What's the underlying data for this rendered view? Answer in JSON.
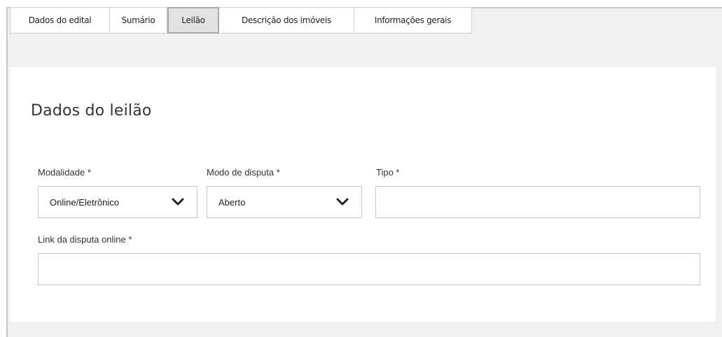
{
  "tabs": [
    {
      "label": "Dados do edital",
      "active": false
    },
    {
      "label": "Sumário",
      "active": false
    },
    {
      "label": "Leilão",
      "active": true
    },
    {
      "label": "Descrição dos imóveis",
      "active": false
    },
    {
      "label": "Informações gerais",
      "active": false
    }
  ],
  "section": {
    "title": "Dados do leilão"
  },
  "form": {
    "modalidade": {
      "label": "Modalidade *",
      "value": "Online/Eletrônico"
    },
    "modo_disputa": {
      "label": "Modo de disputa *",
      "value": "Aberto"
    },
    "tipo": {
      "label": "Tipo *",
      "value": ""
    },
    "link": {
      "label": "Link da disputa online *",
      "value": ""
    }
  }
}
